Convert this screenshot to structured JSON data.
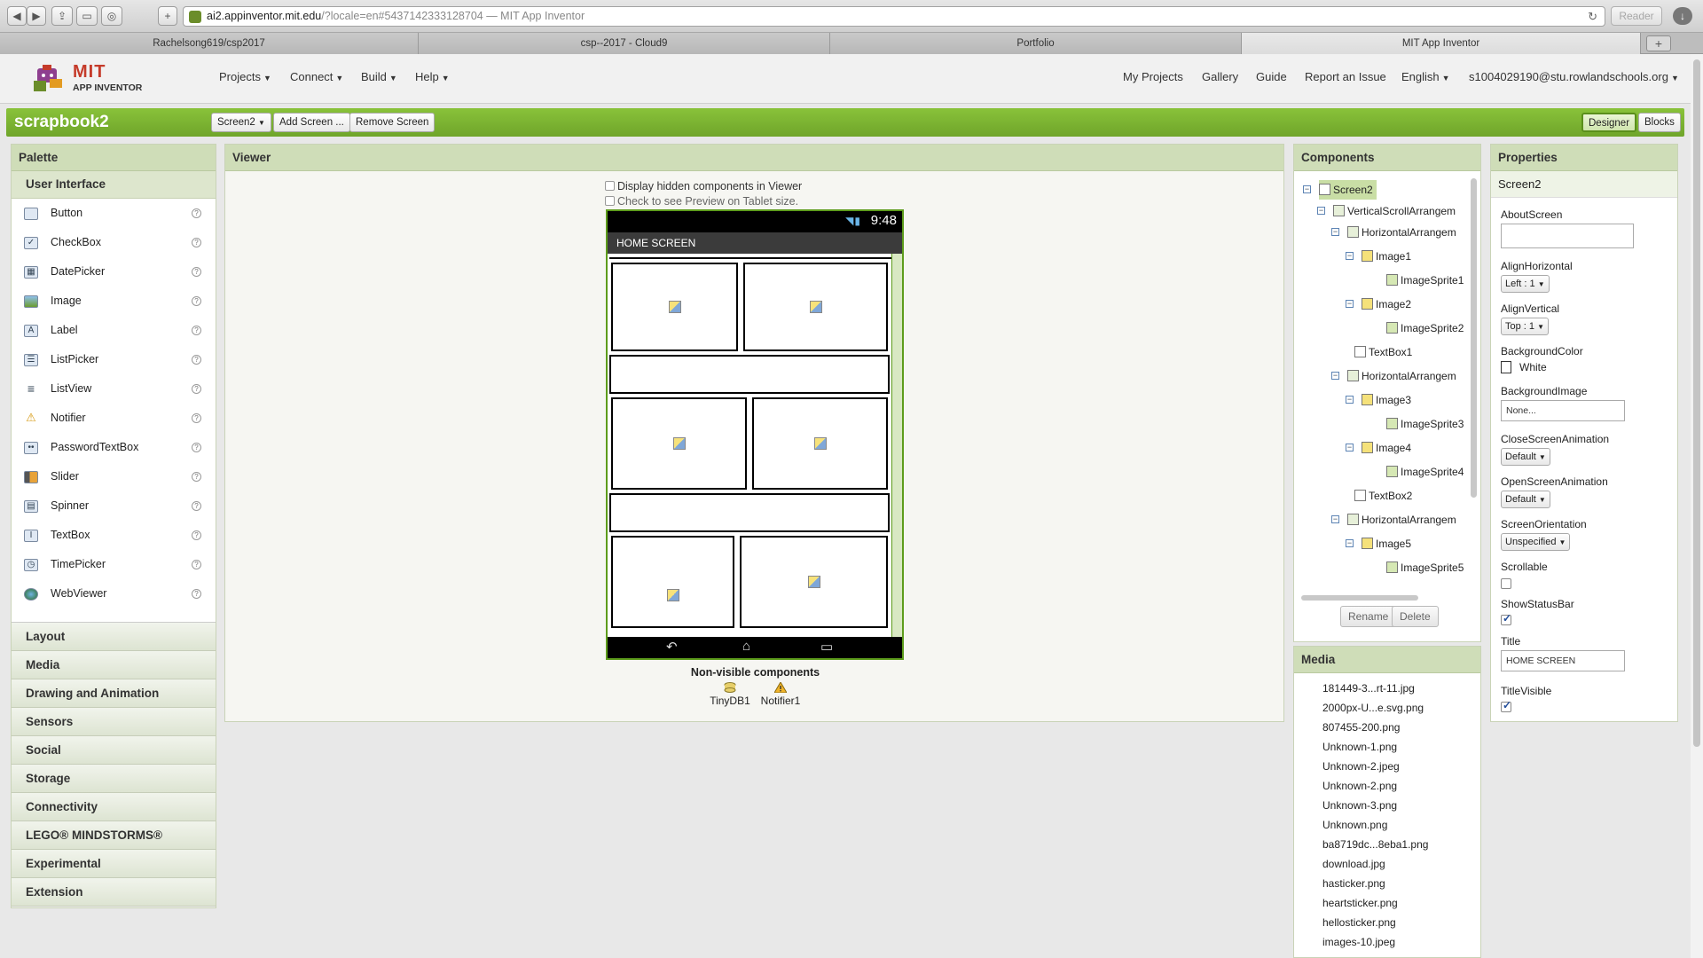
{
  "browser": {
    "url_host": "ai2.appinventor.mit.edu",
    "url_rest": "/?locale=en#5437142333128704 — MIT App Inventor",
    "reader_label": "Reader",
    "tabs": [
      "Rachelsong619/csp2017",
      "csp--2017 - Cloud9",
      "Portfolio",
      "MIT App Inventor"
    ],
    "new_tab_label": "+"
  },
  "header": {
    "logo_text": "MIT",
    "logo_subtext": "APP INVENTOR",
    "menus": [
      "Projects",
      "Connect",
      "Build",
      "Help"
    ],
    "right_links": [
      "My Projects",
      "Gallery",
      "Guide",
      "Report an Issue",
      "English",
      "s1004029190@stu.rowlandschools.org"
    ]
  },
  "project": {
    "name": "scrapbook2",
    "screen_select": "Screen2",
    "add_screen": "Add Screen ...",
    "remove_screen": "Remove Screen",
    "designer": "Designer",
    "blocks": "Blocks"
  },
  "palette": {
    "title": "Palette",
    "open_category": "User Interface",
    "items": [
      "Button",
      "CheckBox",
      "DatePicker",
      "Image",
      "Label",
      "ListPicker",
      "ListView",
      "Notifier",
      "PasswordTextBox",
      "Slider",
      "Spinner",
      "TextBox",
      "TimePicker",
      "WebViewer"
    ],
    "help_glyph": "?",
    "categories": [
      "Layout",
      "Media",
      "Drawing and Animation",
      "Sensors",
      "Social",
      "Storage",
      "Connectivity",
      "LEGO® MINDSTORMS®",
      "Experimental",
      "Extension"
    ]
  },
  "viewer": {
    "title": "Viewer",
    "hidden_check": "Display hidden components in Viewer",
    "tablet_check": "Check to see Preview on Tablet size.",
    "clock": "9:48",
    "screen_title": "HOME SCREEN",
    "nonvisible_title": "Non-visible components",
    "nonvisible": [
      "TinyDB1",
      "Notifier1"
    ]
  },
  "components": {
    "title": "Components",
    "tree": [
      "Screen2",
      "VerticalScrollArrangem",
      "HorizontalArrangem",
      "Image1",
      "ImageSprite1",
      "Image2",
      "ImageSprite2",
      "TextBox1",
      "HorizontalArrangem",
      "Image3",
      "ImageSprite3",
      "Image4",
      "ImageSprite4",
      "TextBox2",
      "HorizontalArrangem",
      "Image5",
      "ImageSprite5"
    ],
    "rename": "Rename",
    "delete": "Delete"
  },
  "media": {
    "title": "Media",
    "files": [
      "181449-3...rt-11.jpg",
      "2000px-U...e.svg.png",
      "807455-200.png",
      "Unknown-1.png",
      "Unknown-2.jpeg",
      "Unknown-2.png",
      "Unknown-3.png",
      "Unknown.png",
      "ba8719dc...8eba1.png",
      "download.jpg",
      "hasticker.png",
      "heartsticker.png",
      "hellosticker.png",
      "images-10.jpeg"
    ]
  },
  "properties": {
    "title": "Properties",
    "component": "Screen2",
    "about_label": "AboutScreen",
    "about_value": "",
    "align_h_label": "AlignHorizontal",
    "align_h_value": "Left : 1",
    "align_v_label": "AlignVertical",
    "align_v_value": "Top : 1",
    "bg_color_label": "BackgroundColor",
    "bg_color_value": "White",
    "bg_image_label": "BackgroundImage",
    "bg_image_value": "None...",
    "close_anim_label": "CloseScreenAnimation",
    "close_anim_value": "Default",
    "open_anim_label": "OpenScreenAnimation",
    "open_anim_value": "Default",
    "orientation_label": "ScreenOrientation",
    "orientation_value": "Unspecified",
    "scrollable_label": "Scrollable",
    "statusbar_label": "ShowStatusBar",
    "title_label": "Title",
    "title_value": "HOME SCREEN",
    "title_visible_label": "TitleVisible"
  }
}
